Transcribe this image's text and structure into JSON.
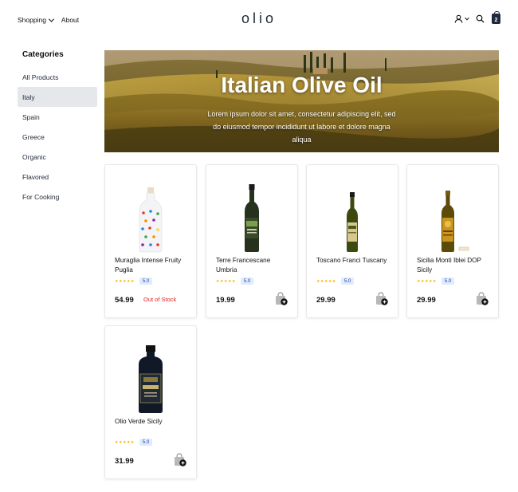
{
  "header": {
    "nav": [
      {
        "label": "Shopping",
        "has_dropdown": true
      },
      {
        "label": "About",
        "has_dropdown": false
      }
    ],
    "logo": "olio",
    "icons": [
      "user-icon",
      "search-icon",
      "cart-icon"
    ],
    "cart_count": "2"
  },
  "sidebar": {
    "title": "Categories",
    "items": [
      {
        "label": "All Products",
        "active": false
      },
      {
        "label": "Italy",
        "active": true
      },
      {
        "label": "Spain",
        "active": false
      },
      {
        "label": "Greece",
        "active": false
      },
      {
        "label": "Organic",
        "active": false
      },
      {
        "label": "Flavored",
        "active": false
      },
      {
        "label": "For Cooking",
        "active": false
      }
    ]
  },
  "hero": {
    "title": "Italian Olive Oil",
    "subtitle": "Lorem ipsum dolor sit amet, consectetur adipiscing elit, sed do eiusmod tempor incididunt ut labore et dolore magna aliqua"
  },
  "products": [
    {
      "name": "Muraglia Intense Fruity Puglia",
      "rating": "5.0",
      "stars": 5,
      "price": "54.99",
      "stock_status": "Out of Stock",
      "bottle": "dotted"
    },
    {
      "name": "Terre Francescane Umbria",
      "rating": "5.0",
      "stars": 5,
      "price": "19.99",
      "stock_status": "",
      "bottle": "dark"
    },
    {
      "name": "Toscano Franci Tuscany",
      "rating": "5.0",
      "stars": 5,
      "price": "29.99",
      "stock_status": "",
      "bottle": "green"
    },
    {
      "name": "Sicilia Monti Iblei DOP Sicily",
      "rating": "5.0",
      "stars": 5,
      "price": "29.99",
      "stock_status": "",
      "bottle": "gold"
    },
    {
      "name": "Olio Verde Sicily",
      "rating": "5.0",
      "stars": 5,
      "price": "31.99",
      "stock_status": "",
      "bottle": "black"
    }
  ],
  "colors": {
    "accent": "#1e293b",
    "out_of_stock": "#dc2626",
    "rating_badge_bg": "#e0ecfb",
    "star": "#f5b301",
    "active_category_bg": "#e5e7eb"
  }
}
